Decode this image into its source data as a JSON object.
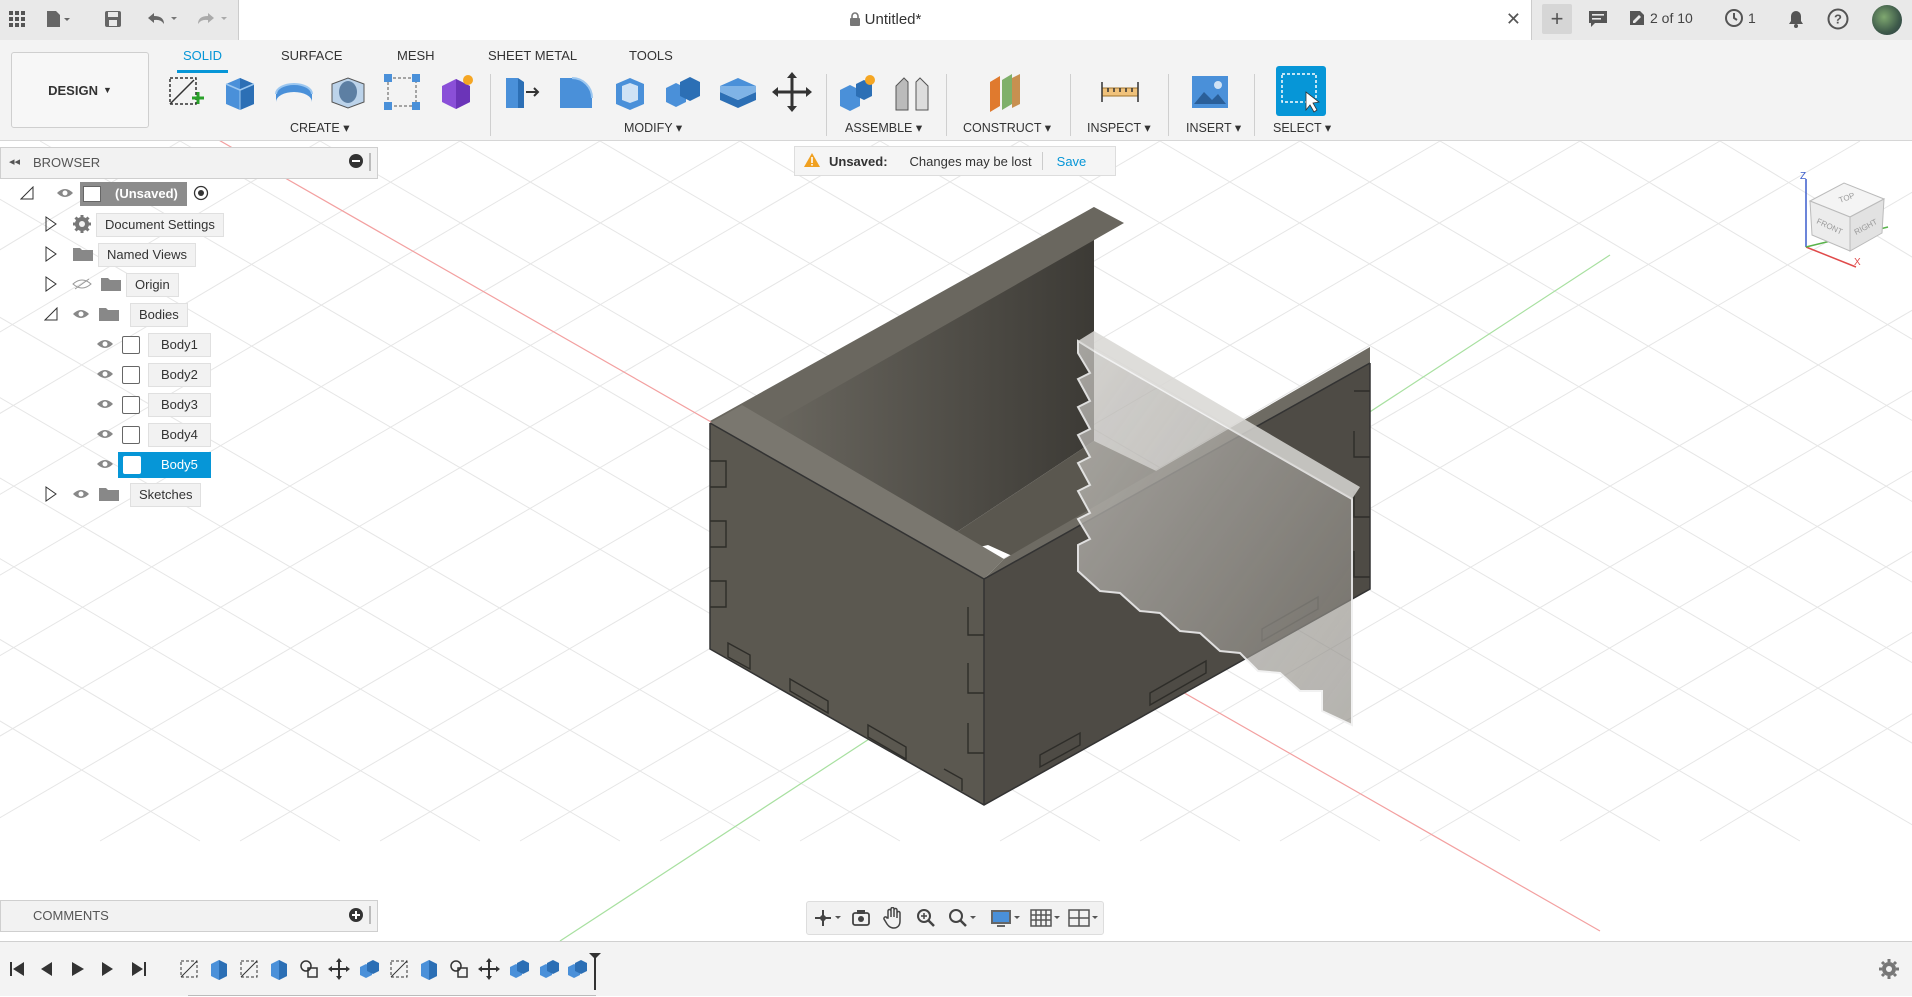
{
  "window": {
    "title": "Untitled*",
    "version_count": "2 of 10",
    "job_count": "1"
  },
  "toolbar": {
    "workspace_label": "DESIGN",
    "tabs": [
      {
        "label": "SOLID",
        "active": true
      },
      {
        "label": "SURFACE",
        "active": false
      },
      {
        "label": "MESH",
        "active": false
      },
      {
        "label": "SHEET METAL",
        "active": false
      },
      {
        "label": "TOOLS",
        "active": false
      }
    ],
    "groups": {
      "create": "CREATE",
      "modify": "MODIFY",
      "assemble": "ASSEMBLE",
      "construct": "CONSTRUCT",
      "inspect": "INSPECT",
      "insert": "INSERT",
      "select": "SELECT"
    }
  },
  "browser": {
    "title": "BROWSER",
    "root": "(Unsaved)",
    "items": [
      {
        "label": "Document Settings"
      },
      {
        "label": "Named Views"
      },
      {
        "label": "Origin"
      },
      {
        "label": "Bodies"
      },
      {
        "label": "Body1"
      },
      {
        "label": "Body2"
      },
      {
        "label": "Body3"
      },
      {
        "label": "Body4"
      },
      {
        "label": "Body5"
      },
      {
        "label": "Sketches"
      }
    ]
  },
  "banner": {
    "status": "Unsaved:",
    "message": "Changes may be lost",
    "action": "Save"
  },
  "comments": {
    "title": "COMMENTS"
  },
  "viewcube": {
    "top": "TOP",
    "front": "FRONT",
    "right": "RIGHT",
    "z": "Z",
    "x": "X"
  },
  "colors": {
    "accent": "#0696d7",
    "body": "#5b5850",
    "body_dark": "#3f3d38",
    "body_light": "#6a675f"
  }
}
